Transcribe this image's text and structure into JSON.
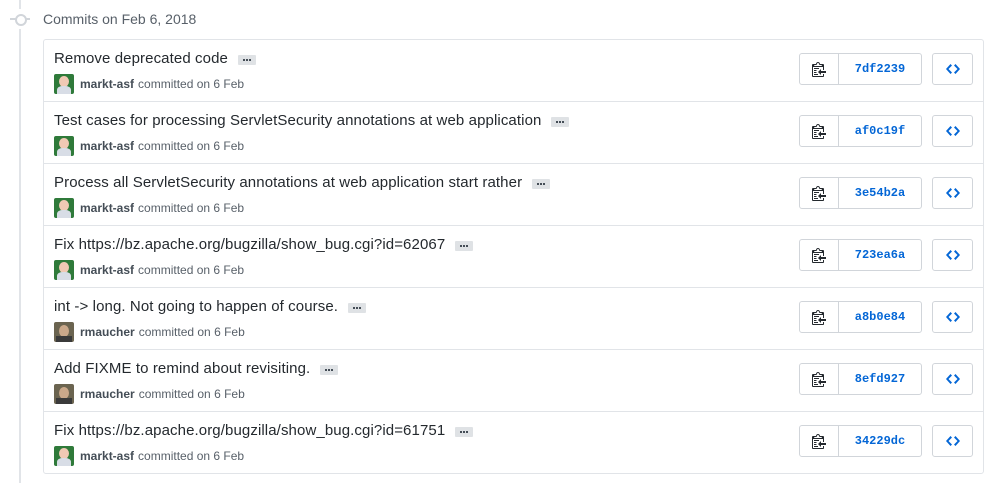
{
  "group": {
    "title": "Commits on Feb 6, 2018"
  },
  "commits": [
    {
      "title": "Remove deprecated code",
      "author": "markt-asf",
      "meta": "committed on 6 Feb",
      "sha": "7df2239",
      "avatar": "markt"
    },
    {
      "title": "Test cases for processing ServletSecurity annotations at web application",
      "author": "markt-asf",
      "meta": "committed on 6 Feb",
      "sha": "af0c19f",
      "avatar": "markt"
    },
    {
      "title": "Process all ServletSecurity annotations at web application start rather",
      "author": "markt-asf",
      "meta": "committed on 6 Feb",
      "sha": "3e54b2a",
      "avatar": "markt"
    },
    {
      "title": "Fix https://bz.apache.org/bugzilla/show_bug.cgi?id=62067",
      "author": "markt-asf",
      "meta": "committed on 6 Feb",
      "sha": "723ea6a",
      "avatar": "markt"
    },
    {
      "title": "int -> long. Not going to happen of course.",
      "author": "rmaucher",
      "meta": "committed on 6 Feb",
      "sha": "a8b0e84",
      "avatar": "rmaucher"
    },
    {
      "title": "Add FIXME to remind about revisiting.",
      "author": "rmaucher",
      "meta": "committed on 6 Feb",
      "sha": "8efd927",
      "avatar": "rmaucher"
    },
    {
      "title": "Fix https://bz.apache.org/bugzilla/show_bug.cgi?id=61751",
      "author": "markt-asf",
      "meta": "committed on 6 Feb",
      "sha": "34229dc",
      "avatar": "markt"
    }
  ],
  "colors": {
    "link": "#0366d6",
    "border": "#d1d5da",
    "muted": "#586069"
  },
  "icons": {
    "copy": "clippy-icon",
    "browse": "code-icon",
    "timeline": "git-commit-icon"
  }
}
